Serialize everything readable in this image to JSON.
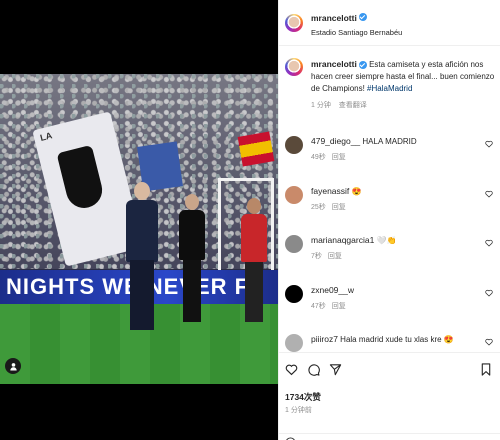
{
  "post": {
    "author": "mrancelotti",
    "location": "Estadio Santiago Bernabéu",
    "caption_text": "Esta camiseta y esta afición nos hacen creer siempre hasta el final... buen comienzo de Champions!",
    "caption_hashtag": "#HalaMadrid",
    "caption_age": "1 分钟",
    "see_translation": "查看翻译",
    "likes": "1734次赞",
    "posted_ago": "1 分钟前"
  },
  "media": {
    "banner_text": "NIGHTS WE NEVER F",
    "flag_text": "LA"
  },
  "comments": [
    {
      "user": "479_diego__",
      "text": "HALA MADRID",
      "age": "49秒",
      "reply": "回复",
      "avatar_color": "#5a4a3a"
    },
    {
      "user": "fayenassif",
      "text": "😍",
      "age": "25秒",
      "reply": "回复",
      "avatar_color": "#c98a6a"
    },
    {
      "user": "marianaqgarcia1",
      "text": "🤍👏",
      "age": "7秒",
      "reply": "回复",
      "avatar_color": "#8a8a8a"
    },
    {
      "user": "zxne09__w",
      "text": "",
      "age": "47秒",
      "reply": "回复",
      "avatar_color": "#000000"
    },
    {
      "user": "piiiroz7",
      "text": "Hala madrid xude tu xlas kre 😍",
      "age": "",
      "reply": "",
      "avatar_color": "#b0b0b0"
    }
  ],
  "icons": {
    "like": "heart-icon",
    "comment": "comment-icon",
    "share": "share-icon",
    "save": "bookmark-icon",
    "tag": "user-tag-icon"
  },
  "colors": {
    "hashtag": "#00376b",
    "verified": "#3897f0",
    "muted": "#8e8e8e"
  }
}
